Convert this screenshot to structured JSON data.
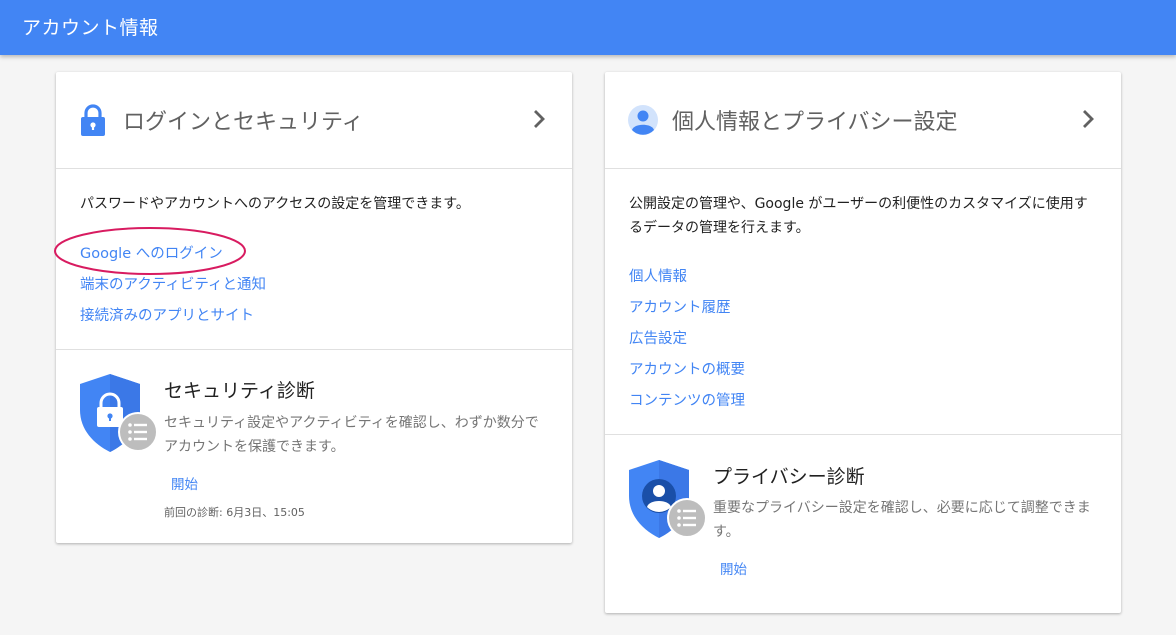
{
  "header": {
    "title": "アカウント情報"
  },
  "login_card": {
    "title": "ログインとセキュリティ",
    "description": "パスワードやアカウントへのアクセスの設定を管理できます。",
    "links": [
      "Google へのログイン",
      "端末のアクティビティと通知",
      "接続済みのアプリとサイト"
    ],
    "checkup": {
      "title": "セキュリティ診断",
      "description": "セキュリティ設定やアクティビティを確認し、わずか数分でアカウントを保護できます。",
      "start_label": "開始",
      "last_check": "前回の診断: 6月3日、15:05"
    }
  },
  "privacy_card": {
    "title": "個人情報とプライバシー設定",
    "description": "公開設定の管理や、Google がユーザーの利便性のカスタマイズに使用するデータの管理を行えます。",
    "links": [
      "個人情報",
      "アカウント履歴",
      "広告設定",
      "アカウントの概要",
      "コンテンツの管理"
    ],
    "checkup": {
      "title": "プライバシー診断",
      "description": "重要なプライバシー設定を確認し、必要に応じて調整できます。",
      "start_label": "開始"
    }
  },
  "colors": {
    "topbar": "#4285f4",
    "link": "#4285f4",
    "highlight": "#d81b60",
    "shield": "#4285f4"
  }
}
